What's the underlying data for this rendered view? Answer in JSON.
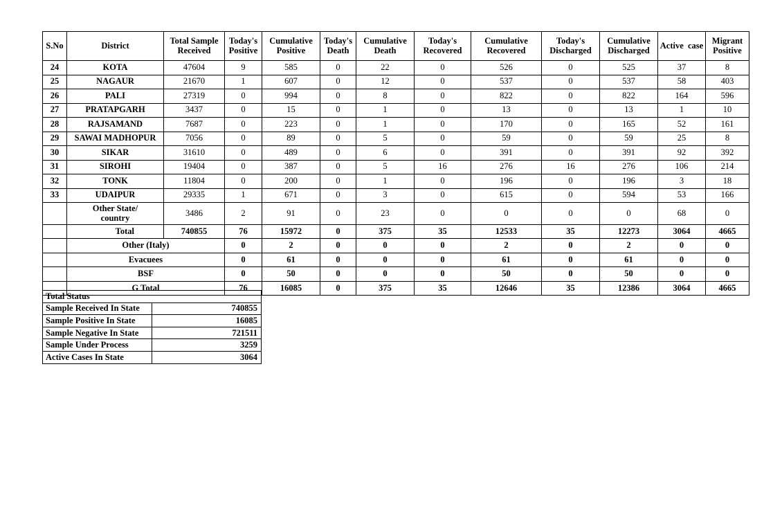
{
  "district_table": {
    "columns": [
      "S.No",
      "District",
      "Total Sample\nReceived",
      "Today's\nPositive",
      "Cumulative\nPositive",
      "Today's\nDeath",
      "Cumulative\nDeath",
      "Today's\nRecovered",
      "Cumulative\nRecovered",
      "Today's\nDischarged",
      "Cumulative\nDischarged",
      "Active  case",
      "Migrant\nPositive"
    ],
    "columns_flat": [
      "S.No",
      "District",
      "Total Sample Received",
      "Today's Positive",
      "Cumulative Positive",
      "Today's Death",
      "Cumulative Death",
      "Today's Recovered",
      "Cumulative Recovered",
      "Today's Discharged",
      "Cumulative Discharged",
      "Active case",
      "Migrant Positive"
    ],
    "rows": [
      {
        "sno": "24",
        "district": "KOTA",
        "total_sample": "47604",
        "today_positive": "9",
        "cum_positive": "585",
        "today_death": "0",
        "cum_death": "22",
        "today_recovered": "0",
        "cum_recovered": "526",
        "today_discharged": "0",
        "cum_discharged": "525",
        "active": "37",
        "migrant": "8"
      },
      {
        "sno": "25",
        "district": "NAGAUR",
        "total_sample": "21670",
        "today_positive": "1",
        "cum_positive": "607",
        "today_death": "0",
        "cum_death": "12",
        "today_recovered": "0",
        "cum_recovered": "537",
        "today_discharged": "0",
        "cum_discharged": "537",
        "active": "58",
        "migrant": "403"
      },
      {
        "sno": "26",
        "district": "PALI",
        "total_sample": "27319",
        "today_positive": "0",
        "cum_positive": "994",
        "today_death": "0",
        "cum_death": "8",
        "today_recovered": "0",
        "cum_recovered": "822",
        "today_discharged": "0",
        "cum_discharged": "822",
        "active": "164",
        "migrant": "596"
      },
      {
        "sno": "27",
        "district": "PRATAPGARH",
        "total_sample": "3437",
        "today_positive": "0",
        "cum_positive": "15",
        "today_death": "0",
        "cum_death": "1",
        "today_recovered": "0",
        "cum_recovered": "13",
        "today_discharged": "0",
        "cum_discharged": "13",
        "active": "1",
        "migrant": "10"
      },
      {
        "sno": "28",
        "district": "RAJSAMAND",
        "total_sample": "7687",
        "today_positive": "0",
        "cum_positive": "223",
        "today_death": "0",
        "cum_death": "1",
        "today_recovered": "0",
        "cum_recovered": "170",
        "today_discharged": "0",
        "cum_discharged": "165",
        "active": "52",
        "migrant": "161"
      },
      {
        "sno": "29",
        "district": "SAWAI MADHOPUR",
        "total_sample": "7056",
        "today_positive": "0",
        "cum_positive": "89",
        "today_death": "0",
        "cum_death": "5",
        "today_recovered": "0",
        "cum_recovered": "59",
        "today_discharged": "0",
        "cum_discharged": "59",
        "active": "25",
        "migrant": "8"
      },
      {
        "sno": "30",
        "district": "SIKAR",
        "total_sample": "31610",
        "today_positive": "0",
        "cum_positive": "489",
        "today_death": "0",
        "cum_death": "6",
        "today_recovered": "0",
        "cum_recovered": "391",
        "today_discharged": "0",
        "cum_discharged": "391",
        "active": "92",
        "migrant": "392"
      },
      {
        "sno": "31",
        "district": "SIROHI",
        "total_sample": "19404",
        "today_positive": "0",
        "cum_positive": "387",
        "today_death": "0",
        "cum_death": "5",
        "today_recovered": "16",
        "cum_recovered": "276",
        "today_discharged": "16",
        "cum_discharged": "276",
        "active": "106",
        "migrant": "214"
      },
      {
        "sno": "32",
        "district": "TONK",
        "total_sample": "11804",
        "today_positive": "0",
        "cum_positive": "200",
        "today_death": "0",
        "cum_death": "1",
        "today_recovered": "0",
        "cum_recovered": "196",
        "today_discharged": "0",
        "cum_discharged": "196",
        "active": "3",
        "migrant": "18"
      },
      {
        "sno": "33",
        "district": "UDAIPUR",
        "total_sample": "29335",
        "today_positive": "1",
        "cum_positive": "671",
        "today_death": "0",
        "cum_death": "3",
        "today_recovered": "0",
        "cum_recovered": "615",
        "today_discharged": "0",
        "cum_discharged": "594",
        "active": "53",
        "migrant": "166"
      },
      {
        "sno": "",
        "district": "Other State/\ncountry",
        "district_line1": "Other State/",
        "district_line2": "country",
        "total_sample": "3486",
        "today_positive": "2",
        "cum_positive": "91",
        "today_death": "0",
        "cum_death": "23",
        "today_recovered": "0",
        "cum_recovered": "0",
        "today_discharged": "0",
        "cum_discharged": "0",
        "active": "68",
        "migrant": "0"
      }
    ],
    "total_row": {
      "label": "Total",
      "total_sample": "740855",
      "today_positive": "76",
      "cum_positive": "15972",
      "today_death": "0",
      "cum_death": "375",
      "today_recovered": "35",
      "cum_recovered": "12533",
      "today_discharged": "35",
      "cum_discharged": "12273",
      "active": "3064",
      "migrant": "4665"
    },
    "sub_rows": [
      {
        "label": "Other (Italy)",
        "today_positive": "0",
        "cum_positive": "2",
        "today_death": "0",
        "cum_death": "0",
        "today_recovered": "0",
        "cum_recovered": "2",
        "today_discharged": "0",
        "cum_discharged": "2",
        "active": "0",
        "migrant": "0"
      },
      {
        "label": "Evacuees",
        "today_positive": "0",
        "cum_positive": "61",
        "today_death": "0",
        "cum_death": "0",
        "today_recovered": "0",
        "cum_recovered": "61",
        "today_discharged": "0",
        "cum_discharged": "61",
        "active": "0",
        "migrant": "0"
      },
      {
        "label": "BSF",
        "today_positive": "0",
        "cum_positive": "50",
        "today_death": "0",
        "cum_death": "0",
        "today_recovered": "0",
        "cum_recovered": "50",
        "today_discharged": "0",
        "cum_discharged": "50",
        "active": "0",
        "migrant": "0"
      },
      {
        "label": "G Total",
        "today_positive": "76",
        "cum_positive": "16085",
        "today_death": "0",
        "cum_death": "375",
        "today_recovered": "35",
        "cum_recovered": "12646",
        "today_discharged": "35",
        "cum_discharged": "12386",
        "active": "3064",
        "migrant": "4665"
      }
    ]
  },
  "status_table": {
    "header": "Total Status",
    "rows": [
      {
        "label": "Sample Received In State",
        "value": "740855"
      },
      {
        "label": "Sample Positive In State",
        "value": "16085"
      },
      {
        "label": "Sample Negative In State",
        "value": "721511"
      },
      {
        "label": "Sample Under Process",
        "value": "3259"
      },
      {
        "label": "Active Cases In State",
        "value": "3064"
      }
    ]
  }
}
